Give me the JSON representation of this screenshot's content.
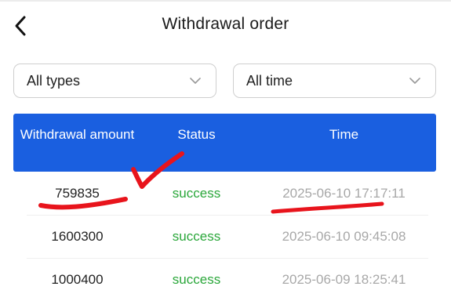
{
  "header": {
    "title": "Withdrawal order",
    "back_icon": "chevron-left-icon"
  },
  "filters": {
    "type": {
      "selected": "All types",
      "icon": "chevron-down-icon"
    },
    "time": {
      "selected": "All time",
      "icon": "chevron-down-icon"
    }
  },
  "table": {
    "columns": [
      "Withdrawal amount",
      "Status",
      "Time"
    ],
    "rows": [
      {
        "amount": "759835",
        "status": "success",
        "time": "2025-06-10 17:17:11"
      },
      {
        "amount": "1600300",
        "status": "success",
        "time": "2025-06-10 09:45:08"
      },
      {
        "amount": "1000400",
        "status": "success",
        "time": "2025-06-09 18:25:41"
      }
    ]
  },
  "colors": {
    "header_blue": "#1a5fe0",
    "success_green": "#2aa73a",
    "time_gray": "#a8a8a8",
    "annotation_red": "#e8141c"
  }
}
